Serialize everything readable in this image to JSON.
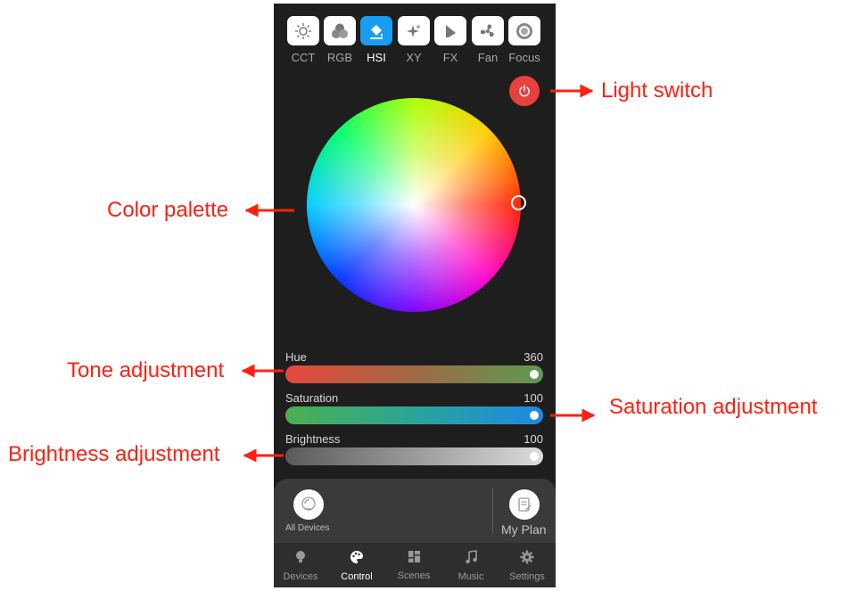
{
  "modes": [
    {
      "label": "CCT",
      "icon": "sun-icon"
    },
    {
      "label": "RGB",
      "icon": "rgb-circles-icon"
    },
    {
      "label": "HSI",
      "icon": "paint-bucket-icon",
      "active": true
    },
    {
      "label": "XY",
      "icon": "sparkle-icon"
    },
    {
      "label": "FX",
      "icon": "fx-shape-icon"
    },
    {
      "label": "Fan",
      "icon": "fan-icon"
    },
    {
      "label": "Focus",
      "icon": "focus-ring-icon"
    }
  ],
  "power_icon": "power-icon",
  "sliders": {
    "hue": {
      "label": "Hue",
      "value": "360"
    },
    "saturation": {
      "label": "Saturation",
      "value": "100"
    },
    "brightness": {
      "label": "Brightness",
      "value": "100"
    }
  },
  "bottom": {
    "all_devices": "All Devices",
    "my_plan": "My Plan"
  },
  "nav": [
    {
      "label": "Devices",
      "icon": "bulb-icon"
    },
    {
      "label": "Control",
      "icon": "palette-icon",
      "active": true
    },
    {
      "label": "Scenes",
      "icon": "scenes-grid-icon"
    },
    {
      "label": "Music",
      "icon": "music-note-icon"
    },
    {
      "label": "Settings",
      "icon": "gear-icon"
    }
  ],
  "annotations": {
    "light_switch": "Light switch",
    "color_palette": "Color palette",
    "tone": "Tone adjustment",
    "saturation": "Saturation adjustment",
    "brightness": "Brightness adjustment"
  },
  "colors": {
    "accent": "#1a9cf0",
    "power": "#e8413d",
    "annotation": "#ff2010",
    "background": "#1e1e1e"
  }
}
